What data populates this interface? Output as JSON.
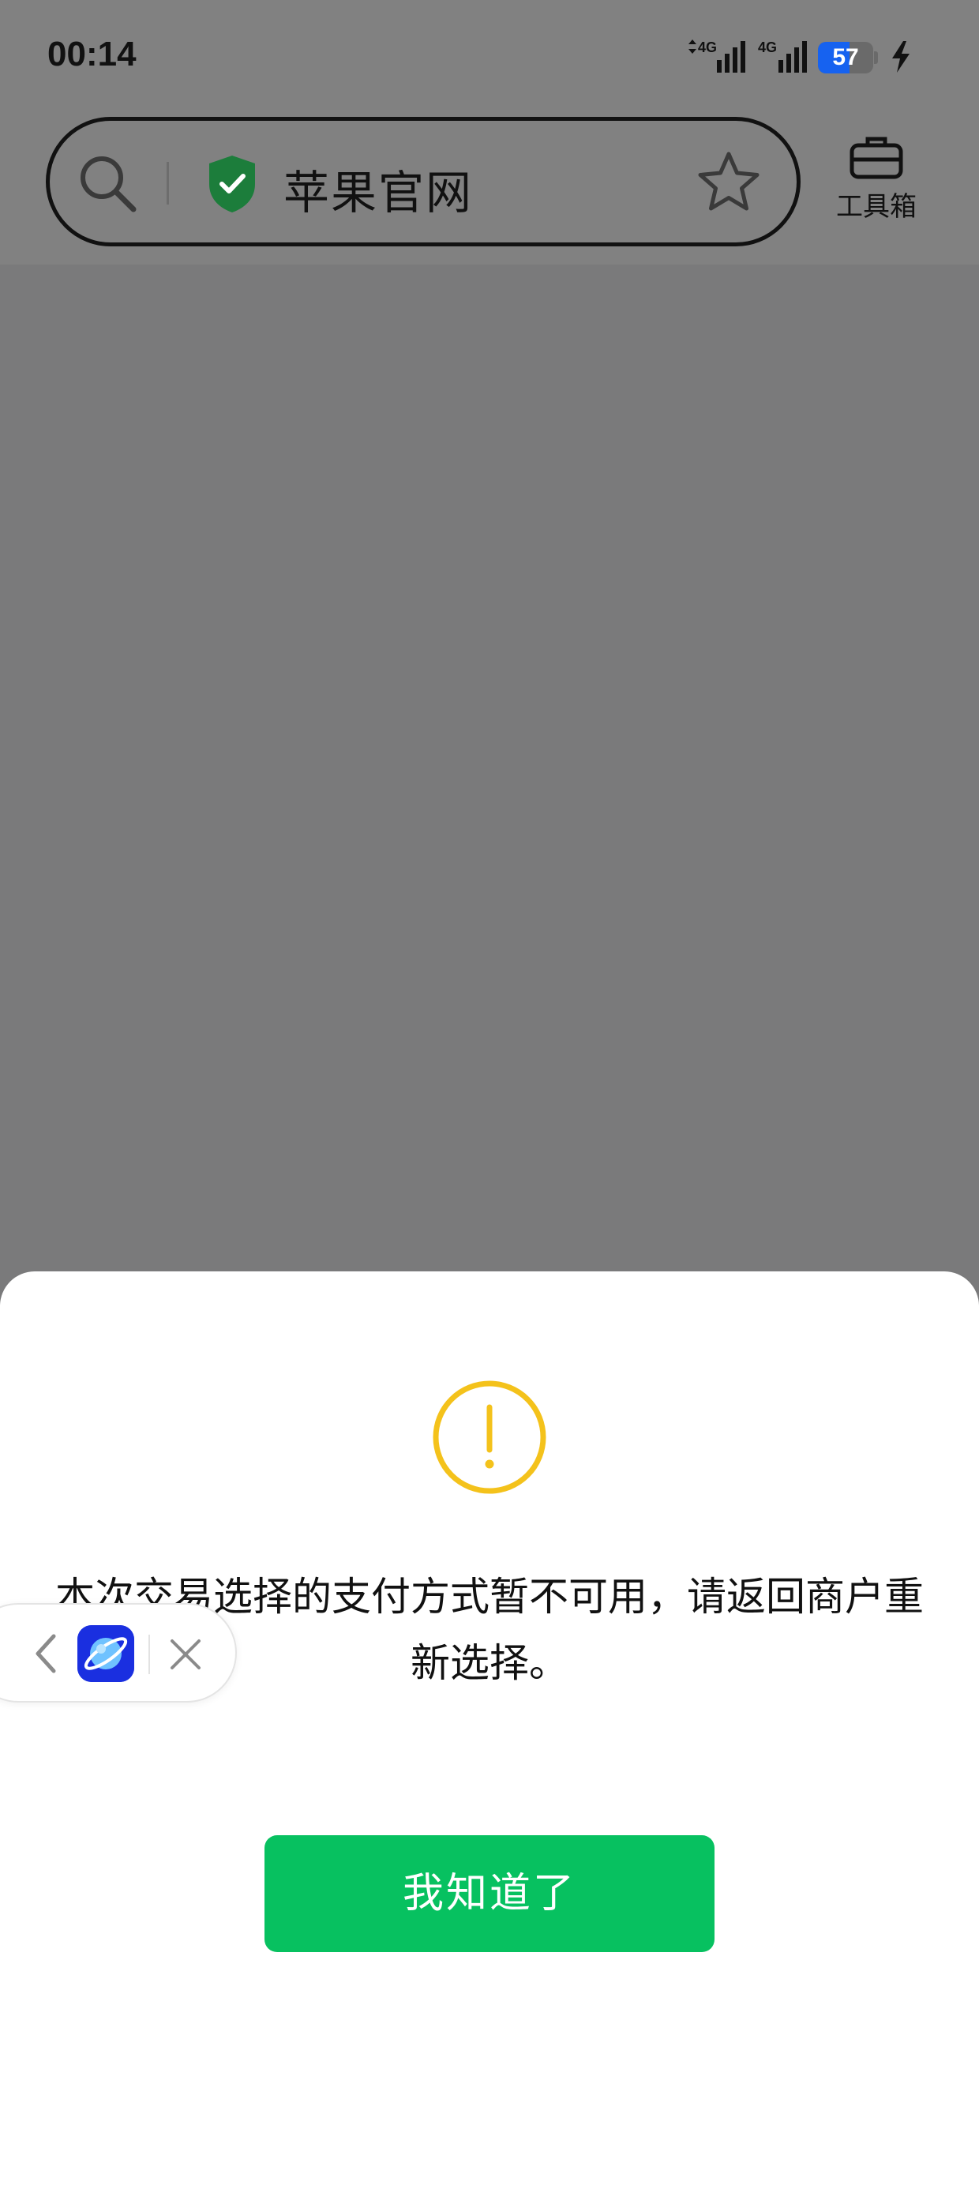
{
  "status_bar": {
    "time": "00:14",
    "signal_1": "4G",
    "signal_2": "4G",
    "battery": "57",
    "battery_level": 0.57,
    "battery_color": "#1662f0"
  },
  "url_bar": {
    "title": "苹果官网",
    "left_icon": "search-icon",
    "security_icon": "shield-check-icon",
    "right_icon": "star-icon"
  },
  "toolbox": {
    "label": "工具箱",
    "icon": "briefcase-icon"
  },
  "dialog": {
    "icon": "warning-icon",
    "icon_color": "#f4c21b",
    "message": "本次交易选择的支付方式暂不可用，请返回商户重新选择。",
    "button_label": "我知道了",
    "button_color": "#07c160"
  },
  "floating_capsule": {
    "back_icon": "chevron-left-icon",
    "app_icon": "planet-app-icon",
    "close_icon": "close-icon"
  }
}
